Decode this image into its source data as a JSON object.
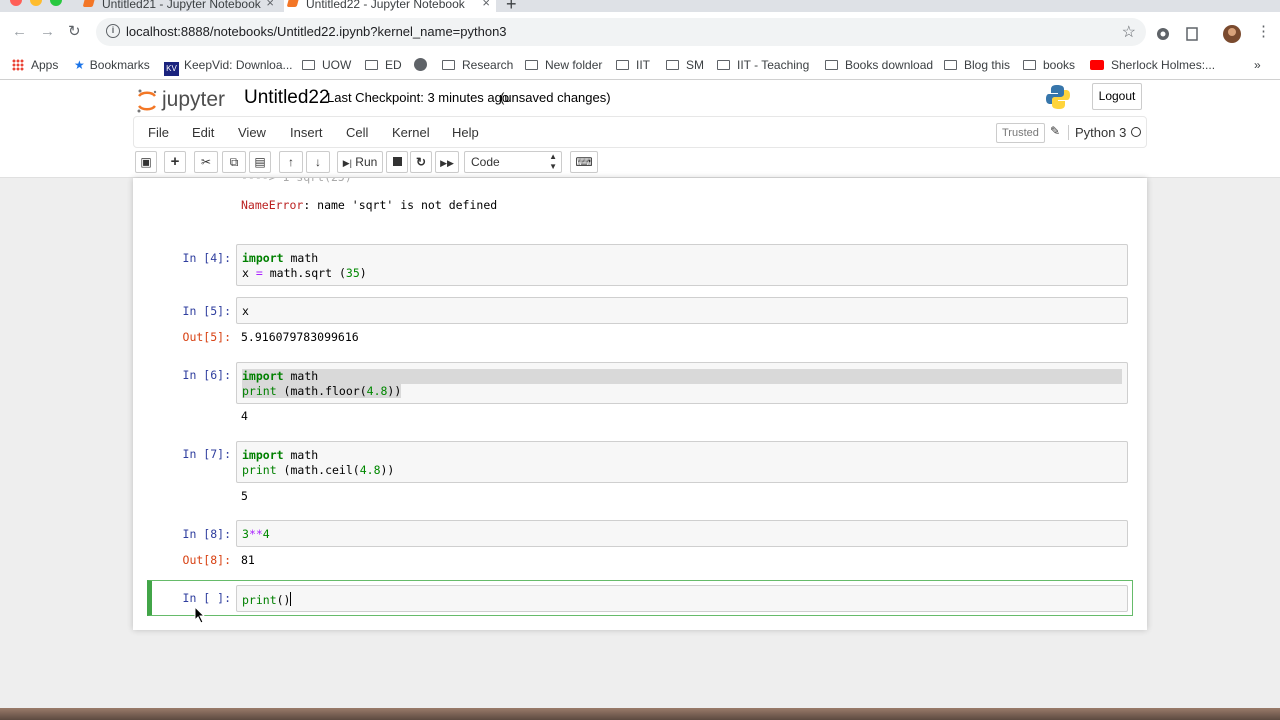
{
  "browser": {
    "tabs": [
      {
        "label": "Untitled21 - Jupyter Notebook"
      },
      {
        "label": "Untitled22 - Jupyter Notebook"
      }
    ],
    "url": "localhost:8888/notebooks/Untitled22.ipynb?kernel_name=python3",
    "bookmarks": [
      {
        "label": "Apps"
      },
      {
        "label": "Bookmarks"
      },
      {
        "label": "KeepVid: Downloa..."
      },
      {
        "label": "UOW"
      },
      {
        "label": "ED"
      },
      {
        "label": "Research"
      },
      {
        "label": "New folder"
      },
      {
        "label": "IIT"
      },
      {
        "label": "SM"
      },
      {
        "label": "IIT - Teaching"
      },
      {
        "label": "Books download"
      },
      {
        "label": "Blog this"
      },
      {
        "label": "books"
      },
      {
        "label": "Sherlock Holmes:..."
      }
    ]
  },
  "jupyter": {
    "logo_text": "jupyter",
    "notebook_name": "Untitled22",
    "checkpoint": "Last Checkpoint: 3 minutes ago",
    "unsaved": "(unsaved changes)",
    "logout_label": "Logout",
    "menu": [
      "File",
      "Edit",
      "View",
      "Insert",
      "Cell",
      "Kernel",
      "Help"
    ],
    "trusted": "Trusted",
    "kernel_name": "Python 3",
    "toolbar": {
      "run_label": "Run",
      "cell_type": "Code"
    }
  },
  "cells": {
    "error_line": "NameError: name 'sqrt' is not defined",
    "error_name": "NameError",
    "error_msg": ": name 'sqrt' is not defined",
    "c4": {
      "prompt": "In [4]:",
      "line1_kw": "import",
      "line1_rest": " math",
      "line2_a": "x ",
      "line2_op": "=",
      "line2_b": " math.sqrt (",
      "line2_num": "35",
      "line2_c": ")"
    },
    "c5": {
      "prompt": "In [5]:",
      "code": "x",
      "out_prompt": "Out[5]:",
      "output": "5.916079783099616"
    },
    "c6": {
      "prompt": "In [6]:",
      "line1_kw": "import",
      "line1_rest": " math",
      "line2_kw": "print",
      "line2_a": " (math.floor(",
      "line2_num": "4.8",
      "line2_c": "))",
      "output": "4"
    },
    "c7": {
      "prompt": "In [7]:",
      "line1_kw": "import",
      "line1_rest": " math",
      "line2_kw": "print",
      "line2_a": " (math.ceil(",
      "line2_num": "4.8",
      "line2_c": "))",
      "output": "5"
    },
    "c8": {
      "prompt": "In [8]:",
      "num1": "3",
      "op": "**",
      "num2": "4",
      "out_prompt": "Out[8]:",
      "output": "81"
    },
    "c9": {
      "prompt": "In [ ]:",
      "kw": "print",
      "rest": "()"
    }
  }
}
